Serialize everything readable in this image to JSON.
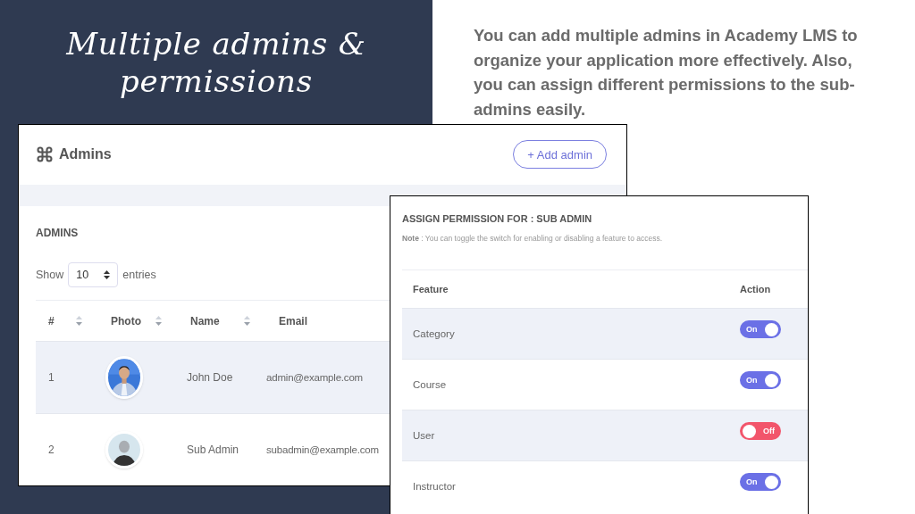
{
  "slide": {
    "title": "Multiple admins & permissions",
    "description": "You can add multiple admins in Academy LMS to organize your application more effectively. Also, you can assign different permissions to the sub-admins easily."
  },
  "admins_window": {
    "title": "Admins",
    "add_button": "+ Add admin",
    "section_title": "ADMINS",
    "show_label": "Show",
    "page_size": "10",
    "entries_label": "entries",
    "columns": [
      {
        "label": "#",
        "sortable": true
      },
      {
        "label": "Photo",
        "sortable": true
      },
      {
        "label": "Name",
        "sortable": true
      },
      {
        "label": "Email",
        "sortable": false
      }
    ],
    "rows": [
      {
        "number": "1",
        "name": "John Doe",
        "email": "admin@example.com",
        "highlighted": true
      },
      {
        "number": "2",
        "name": "Sub Admin",
        "email": "subadmin@example.com",
        "kind": "silhouette",
        "highlighted": false
      }
    ]
  },
  "permissions_window": {
    "title": "ASSIGN PERMISSION FOR : SUB ADMIN",
    "note_label": "Note",
    "note": " : You can toggle the switch for enabling or disabling a feature to access.",
    "columns": [
      "Feature",
      "Action"
    ],
    "features": [
      {
        "name": "Category",
        "on": true,
        "switch_label": "On"
      },
      {
        "name": "Course",
        "on": true,
        "switch_label": "On"
      },
      {
        "name": "User",
        "on": false,
        "switch_label": "Off"
      },
      {
        "name": "Instructor",
        "on": true,
        "switch_label": "On"
      }
    ]
  }
}
